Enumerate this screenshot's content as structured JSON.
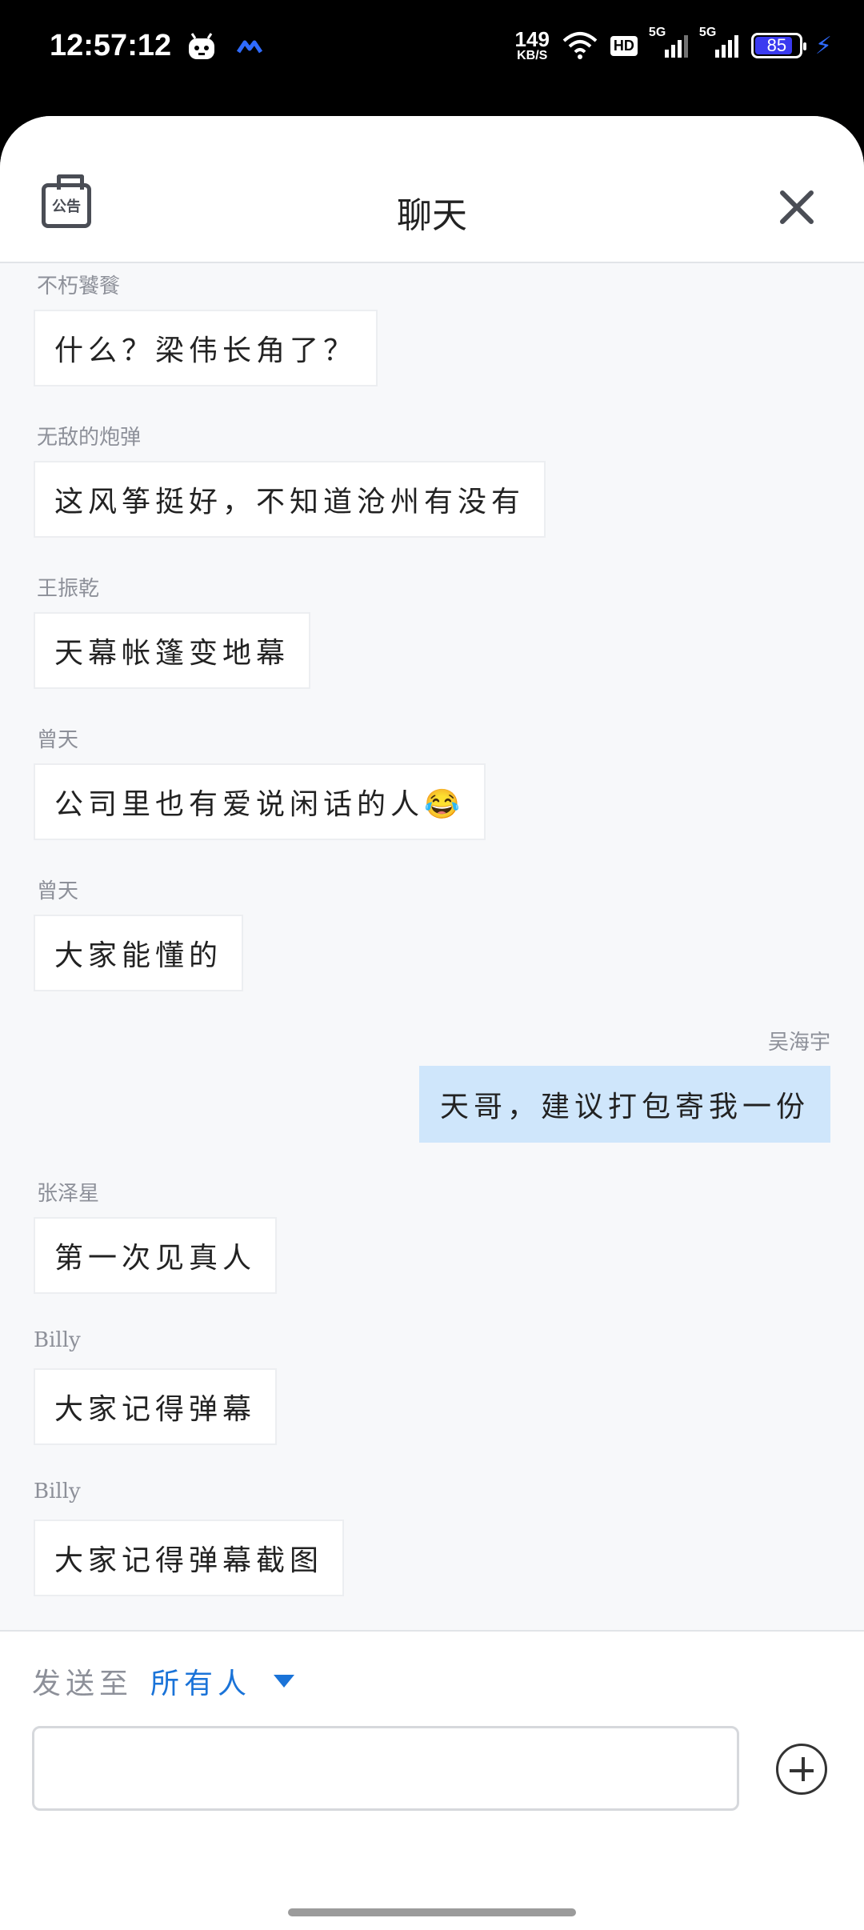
{
  "status": {
    "time": "12:57:12",
    "net_speed": "149",
    "net_unit": "KB/S",
    "hd": "HD",
    "signal1": "5G",
    "signal2": "5G",
    "battery": "85",
    "battery_level": 0.85,
    "accent": "#2f6bff"
  },
  "header": {
    "notice_label": "公告",
    "title": "聊天"
  },
  "messages": [
    {
      "sender": "不朽饕餮",
      "text": "什么？梁伟长角了？",
      "mine": false
    },
    {
      "sender": "无敌的炮弹",
      "text": "这风筝挺好，不知道沧州有没有",
      "mine": false
    },
    {
      "sender": "王振乾",
      "text": "天幕帐篷变地幕",
      "mine": false
    },
    {
      "sender": "曾天",
      "text": "公司里也有爱说闲话的人😂",
      "mine": false
    },
    {
      "sender": "曾天",
      "text": "大家能懂的",
      "mine": false
    },
    {
      "sender": "吴海宇",
      "text": "天哥，建议打包寄我一份",
      "mine": true
    },
    {
      "sender": "张泽星",
      "text": "第一次见真人",
      "mine": false
    },
    {
      "sender": "Billy",
      "text": "大家记得弹幕",
      "mine": false
    },
    {
      "sender": "Billy",
      "text": "大家记得弹幕截图",
      "mine": false
    }
  ],
  "footer": {
    "send_to_label": "发送至",
    "send_to_target": "所有人",
    "input_value": "",
    "target_color": "#1a73d8"
  }
}
